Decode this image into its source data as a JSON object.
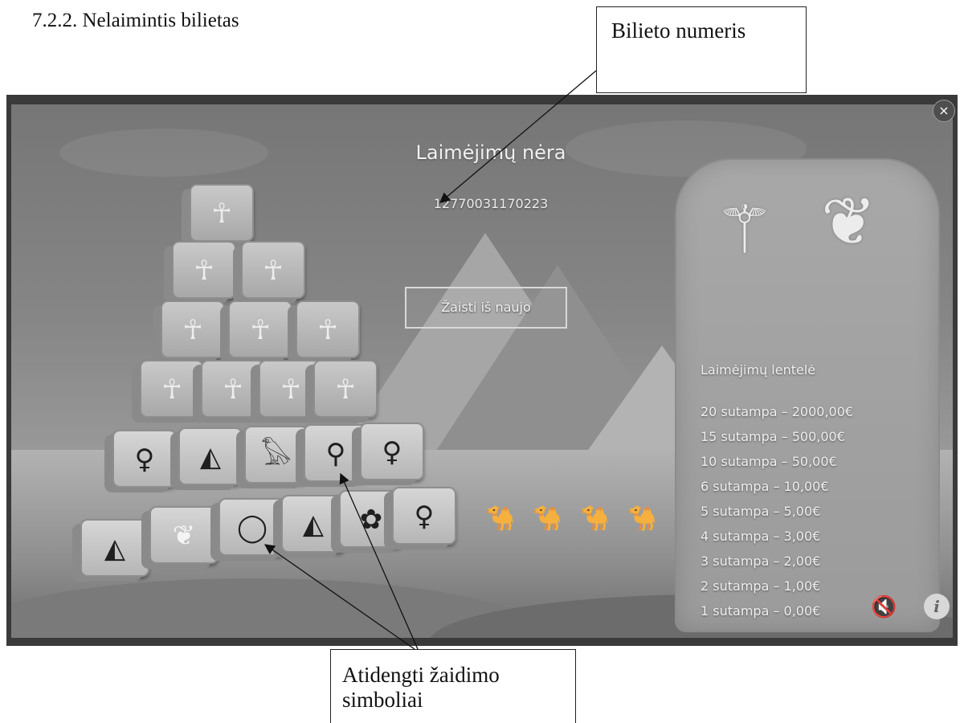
{
  "doc": {
    "section_heading": "7.2.2.   Nelaimintis bilietas",
    "callout_ticket": "Bilieto  numeris",
    "callout_symbols": "Atidengti žaidimo simboliai"
  },
  "game": {
    "status_title": "Laimėjimų nėra",
    "ticket_number": "12770031170223",
    "replay_button": "Žaisti iš naujo",
    "close_label": "×",
    "prize_table": {
      "heading": "Laimėjimų lentelė",
      "rows": [
        "20 sutampa – 2000,00€",
        "15 sutampa – 500,00€",
        "10 sutampa – 50,00€",
        "6 sutampa – 10,00€",
        "5 sutampa – 5,00€",
        "4 sutampa – 3,00€",
        "3 sutampa – 2,00€",
        "2 sutampa – 1,00€",
        "1 sutampa – 0,00€"
      ]
    },
    "cubes": {
      "row1": [
        "☥"
      ],
      "row2": [
        "☥",
        "☥"
      ],
      "row3": [
        "☥",
        "☥",
        "☥"
      ],
      "row4": [
        "☥",
        "☥",
        "☥",
        "☥"
      ],
      "row5": [
        "♀",
        "◭",
        "𓅃",
        "⚲",
        "♀"
      ],
      "row6": [
        "◭",
        "❦",
        "◯",
        "◭",
        "✿",
        "♀"
      ]
    },
    "colors": {
      "frame": "#3a3a3a",
      "stone": "#b8b8b8"
    }
  }
}
